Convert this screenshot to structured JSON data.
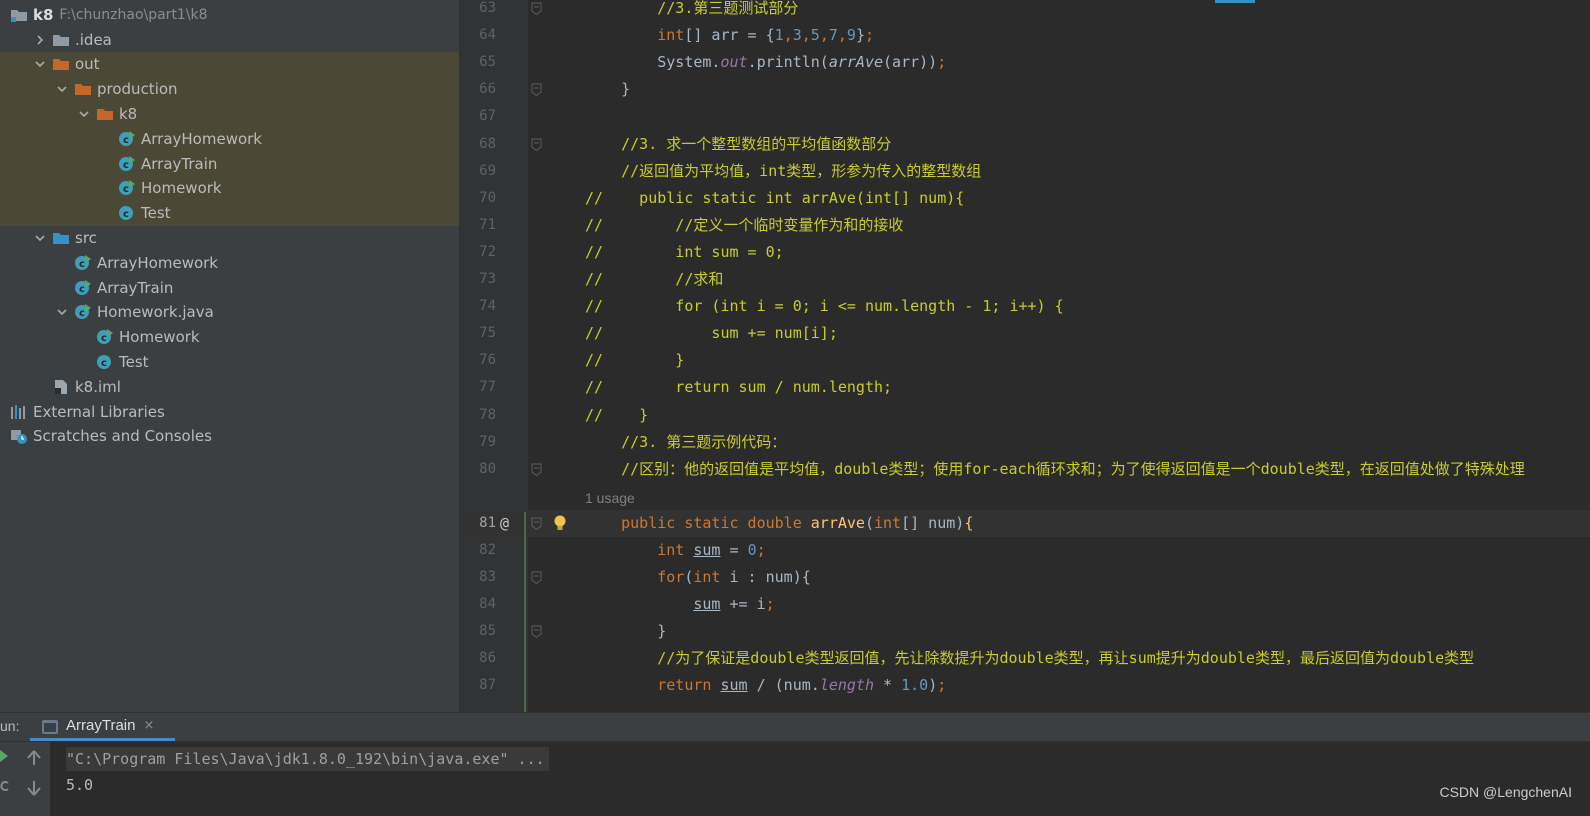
{
  "project_tree": {
    "root_name": "k8",
    "root_path": "F:\\chunzhao\\part1\\k8",
    "items": [
      {
        "label": ".idea",
        "kind": "folder-grey",
        "depth": 1,
        "arrow": "right"
      },
      {
        "label": "out",
        "kind": "folder-orange",
        "depth": 1,
        "arrow": "down",
        "highlight": true
      },
      {
        "label": "production",
        "kind": "folder-orange",
        "depth": 2,
        "arrow": "down",
        "highlight": true
      },
      {
        "label": "k8",
        "kind": "folder-orange",
        "depth": 3,
        "arrow": "down",
        "highlight": true
      },
      {
        "label": "ArrayHomework",
        "kind": "class-run",
        "depth": 4,
        "arrow": "none",
        "highlight": true
      },
      {
        "label": "ArrayTrain",
        "kind": "class-run",
        "depth": 4,
        "arrow": "none",
        "highlight": true
      },
      {
        "label": "Homework",
        "kind": "class-run",
        "depth": 4,
        "arrow": "none",
        "highlight": true
      },
      {
        "label": "Test",
        "kind": "class",
        "depth": 4,
        "arrow": "none",
        "highlight": true
      },
      {
        "label": "src",
        "kind": "folder-blue",
        "depth": 1,
        "arrow": "down"
      },
      {
        "label": "ArrayHomework",
        "kind": "class-run",
        "depth": 2,
        "arrow": "none"
      },
      {
        "label": "ArrayTrain",
        "kind": "class-run",
        "depth": 2,
        "arrow": "none"
      },
      {
        "label": "Homework.java",
        "kind": "class-run",
        "depth": 2,
        "arrow": "down"
      },
      {
        "label": "Homework",
        "kind": "class-run",
        "depth": 3,
        "arrow": "none"
      },
      {
        "label": "Test",
        "kind": "class",
        "depth": 3,
        "arrow": "none"
      },
      {
        "label": "k8.iml",
        "kind": "file-iml",
        "depth": 1,
        "arrow": "none"
      },
      {
        "label": "External Libraries",
        "kind": "libraries",
        "depth": 0,
        "arrow": "none"
      },
      {
        "label": "Scratches and Consoles",
        "kind": "scratches",
        "depth": 0,
        "arrow": "none"
      }
    ]
  },
  "editor": {
    "usage_hint": "1 usage",
    "usage_after_line": 80,
    "current_line": 81,
    "lines": [
      {
        "n": 63,
        "fold": true,
        "tokens": [
          [
            "        ",
            ""
          ],
          [
            "//3.第三题测试部分",
            "cmt"
          ]
        ]
      },
      {
        "n": 64,
        "tokens": [
          [
            "        ",
            ""
          ],
          [
            "int",
            "kw"
          ],
          [
            "[] arr = {",
            ""
          ],
          [
            "1",
            "num"
          ],
          [
            ",",
            "kw"
          ],
          [
            "3",
            "num"
          ],
          [
            ",",
            "kw"
          ],
          [
            "5",
            "num"
          ],
          [
            ",",
            "kw"
          ],
          [
            "7",
            "num"
          ],
          [
            ",",
            "kw"
          ],
          [
            "9",
            "num"
          ],
          [
            "}",
            ""
          ],
          [
            ";",
            "kw"
          ]
        ]
      },
      {
        "n": 65,
        "tokens": [
          [
            "        System.",
            ""
          ],
          [
            "out",
            "stat"
          ],
          [
            ".println(",
            ""
          ],
          [
            "arrAve",
            "ital"
          ],
          [
            "(arr))",
            ""
          ],
          [
            ";",
            "kw"
          ]
        ]
      },
      {
        "n": 66,
        "fold": true,
        "tokens": [
          [
            "    }",
            ""
          ]
        ]
      },
      {
        "n": 67,
        "tokens": []
      },
      {
        "n": 68,
        "fold": true,
        "tokens": [
          [
            "    ",
            ""
          ],
          [
            "//3. 求一个整型数组的平均值函数部分",
            "cmt"
          ]
        ]
      },
      {
        "n": 69,
        "tokens": [
          [
            "    ",
            ""
          ],
          [
            "//返回值为平均值，int类型，形参为传入的整型数组",
            "cmt"
          ]
        ]
      },
      {
        "n": 70,
        "tokens": [
          [
            "//    public static int arrAve(int[] num){",
            "cmt"
          ]
        ]
      },
      {
        "n": 71,
        "tokens": [
          [
            "//        //定义一个临时变量作为和的接收",
            "cmt"
          ]
        ]
      },
      {
        "n": 72,
        "tokens": [
          [
            "//        int sum = 0;",
            "cmt"
          ]
        ]
      },
      {
        "n": 73,
        "tokens": [
          [
            "//        //求和",
            "cmt"
          ]
        ]
      },
      {
        "n": 74,
        "tokens": [
          [
            "//        for (int i = 0; i <= num.length - 1; i++) {",
            "cmt"
          ]
        ]
      },
      {
        "n": 75,
        "tokens": [
          [
            "//            sum += num[i];",
            "cmt"
          ]
        ]
      },
      {
        "n": 76,
        "tokens": [
          [
            "//        }",
            "cmt"
          ]
        ]
      },
      {
        "n": 77,
        "tokens": [
          [
            "//        return sum / num.length;",
            "cmt"
          ]
        ]
      },
      {
        "n": 78,
        "tokens": [
          [
            "//    }",
            "cmt"
          ]
        ]
      },
      {
        "n": 79,
        "tokens": [
          [
            "    ",
            ""
          ],
          [
            "//3. 第三题示例代码：",
            "cmt"
          ]
        ]
      },
      {
        "n": 80,
        "fold": true,
        "tokens": [
          [
            "    ",
            ""
          ],
          [
            "//区别：他的返回值是平均值，double类型；使用for-each循环求和；为了使得返回值是一个double类型，在返回值处做了特殊处理",
            "cmt"
          ]
        ]
      },
      {
        "n": 81,
        "fold": true,
        "annotation": "@",
        "bulb": true,
        "tokens": [
          [
            "    ",
            ""
          ],
          [
            "public static double ",
            "kw"
          ],
          [
            "arrAve",
            "fnc"
          ],
          [
            "(",
            ""
          ],
          [
            "int",
            "kw"
          ],
          [
            "[] num)",
            ""
          ],
          [
            "{",
            "fnc"
          ]
        ]
      },
      {
        "n": 82,
        "tokens": [
          [
            "        ",
            ""
          ],
          [
            "int ",
            "kw"
          ],
          [
            "sum",
            "var"
          ],
          [
            " = ",
            ""
          ],
          [
            "0",
            "num"
          ],
          [
            ";",
            "kw"
          ]
        ]
      },
      {
        "n": 83,
        "fold": true,
        "tokens": [
          [
            "        ",
            ""
          ],
          [
            "for",
            "kw"
          ],
          [
            "(",
            ""
          ],
          [
            "int ",
            "kw"
          ],
          [
            "i : num){",
            ""
          ]
        ]
      },
      {
        "n": 84,
        "tokens": [
          [
            "            ",
            ""
          ],
          [
            "sum",
            "var"
          ],
          [
            " += i",
            ""
          ],
          [
            ";",
            "kw"
          ]
        ]
      },
      {
        "n": 85,
        "fold": true,
        "tokens": [
          [
            "        }",
            ""
          ]
        ]
      },
      {
        "n": 86,
        "tokens": [
          [
            "        ",
            ""
          ],
          [
            "//为了保证是double类型返回值，先让除数提升为double类型，再让sum提升为double类型，最后返回值为double类型",
            "cmt"
          ]
        ]
      },
      {
        "n": 87,
        "tokens": [
          [
            "        ",
            ""
          ],
          [
            "return ",
            "kw"
          ],
          [
            "sum",
            "var"
          ],
          [
            " / (num.",
            ""
          ],
          [
            "length",
            "stat"
          ],
          [
            " * ",
            ""
          ],
          [
            "1.0",
            "num"
          ],
          [
            ")",
            ""
          ],
          [
            ";",
            "kw"
          ]
        ]
      }
    ]
  },
  "run_panel": {
    "label": "un:",
    "tab_label": "ArrayTrain",
    "tab_close": "×",
    "console": {
      "command": "\"C:\\Program Files\\Java\\jdk1.8.0_192\\bin\\java.exe\" ...",
      "output": "5.0"
    }
  },
  "watermark": "CSDN @LengchenAI",
  "colors": {
    "folder_orange": "#c5672b",
    "folder_blue": "#3592c4",
    "folder_grey": "#8f9aa4",
    "class_teal": "#3f9fb8",
    "comment": "#c8cd27",
    "keyword": "#cc7832"
  }
}
